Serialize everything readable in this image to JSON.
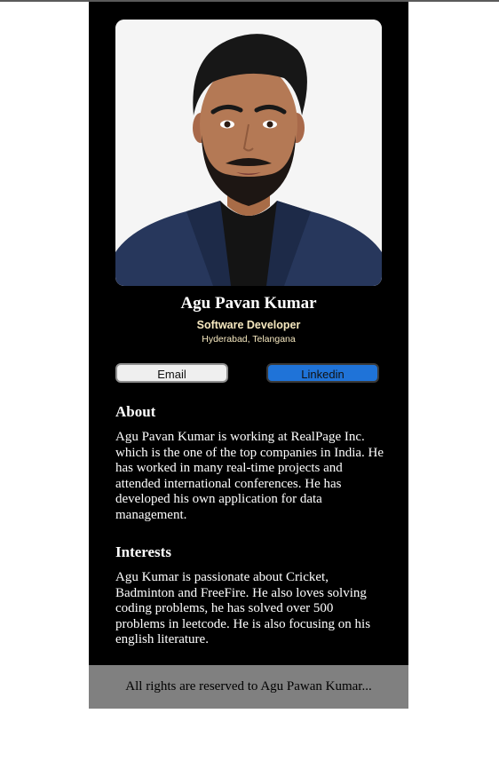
{
  "profile": {
    "name": "Agu Pavan Kumar",
    "role": "Software Developer",
    "location": "Hyderabad, Telangana"
  },
  "buttons": {
    "email_label": "Email",
    "linkedin_label": "Linkedin"
  },
  "about": {
    "title": "About",
    "body": "Agu Pavan Kumar is working at RealPage Inc. which is the one of the top companies in India. He has worked in many real-time projects and attended international conferences. He has developed his own application for data management."
  },
  "interests": {
    "title": "Interests",
    "body": "Agu Kumar is passionate about Cricket, Badminton and FreeFire. He also loves solving coding problems, he has solved over 500 problems in leetcode. He is also focusing on his english literature."
  },
  "footer": {
    "text": "All rights are reserved to Agu Pawan Kumar..."
  },
  "colors": {
    "card_background": "#000000",
    "subtitle": "#f7e9c0",
    "linkedin": "#1f73d8",
    "email": "#efefef",
    "footer": "#808080"
  }
}
